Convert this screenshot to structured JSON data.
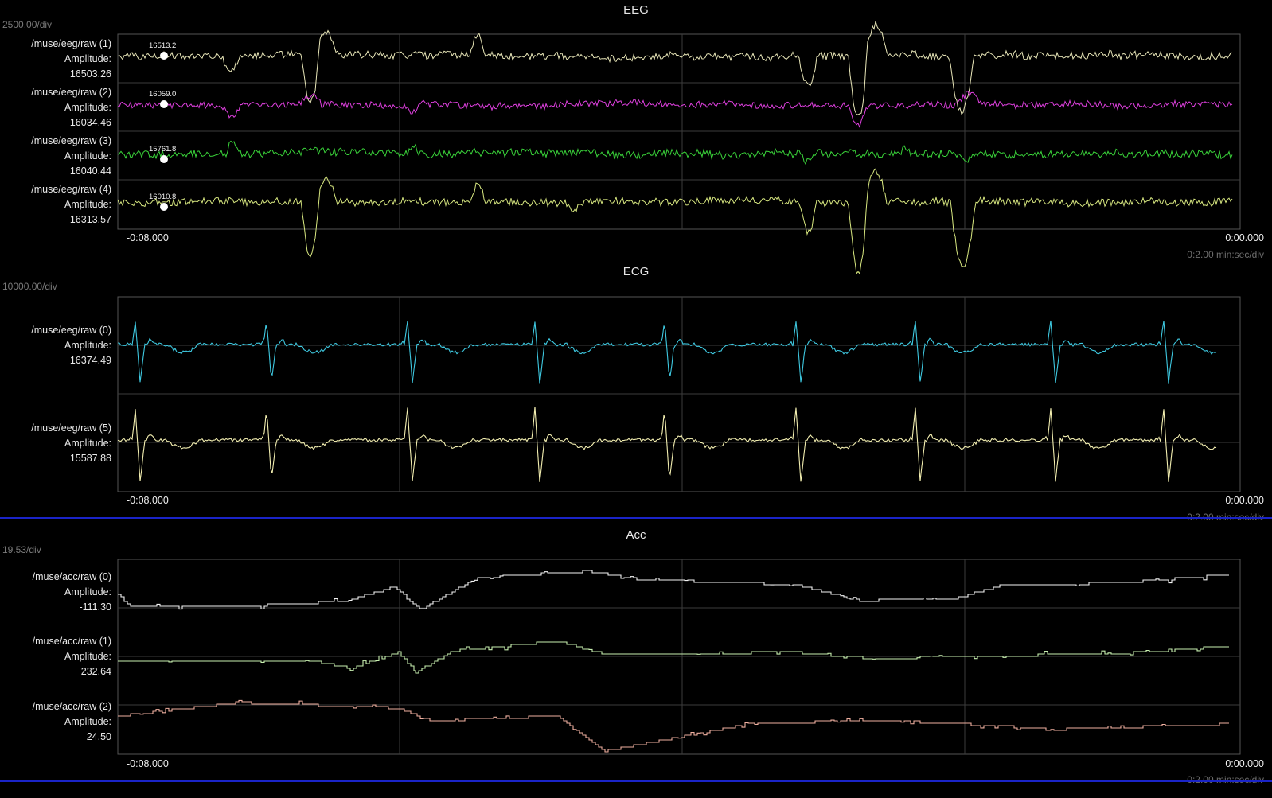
{
  "eeg": {
    "title": "EEG",
    "scale": "2500.00/div",
    "time_left": "-0:08.000",
    "time_right": "0:00.000",
    "time_div": "0:2.00 min:sec/div",
    "channels": [
      {
        "name": "/muse/eeg/raw (1)",
        "amp_label": "Amplitude:",
        "value": "16503.26",
        "cursor": "16513.2",
        "color": "#e8e6b8"
      },
      {
        "name": "/muse/eeg/raw (2)",
        "amp_label": "Amplitude:",
        "value": "16034.46",
        "cursor": "16059.0",
        "color": "#e040e0"
      },
      {
        "name": "/muse/eeg/raw (3)",
        "amp_label": "Amplitude:",
        "value": "16040.44",
        "cursor": "15761.8",
        "color": "#3ad43a"
      },
      {
        "name": "/muse/eeg/raw (4)",
        "amp_label": "Amplitude:",
        "value": "16313.57",
        "cursor": "16010.8",
        "color": "#d8e880"
      }
    ]
  },
  "ecg": {
    "title": "ECG",
    "scale": "10000.00/div",
    "time_left": "-0:08.000",
    "time_right": "0:00.000",
    "time_div": "0:2.00 min:sec/div",
    "channels": [
      {
        "name": "/muse/eeg/raw (0)",
        "amp_label": "Amplitude:",
        "value": "16374.49",
        "color": "#3ec8e0"
      },
      {
        "name": "/muse/eeg/raw (5)",
        "amp_label": "Amplitude:",
        "value": "15587.88",
        "color": "#f2eeb0"
      }
    ]
  },
  "acc": {
    "title": "Acc",
    "scale": "19.53/div",
    "time_left": "-0:08.000",
    "time_right": "0:00.000",
    "time_div": "0:2.00 min:sec/div",
    "channels": [
      {
        "name": "/muse/acc/raw (0)",
        "amp_label": "Amplitude:",
        "value": "-111.30",
        "color": "#f4f4f4"
      },
      {
        "name": "/muse/acc/raw (1)",
        "amp_label": "Amplitude:",
        "value": "232.64",
        "color": "#c8f0b0"
      },
      {
        "name": "/muse/acc/raw (2)",
        "amp_label": "Amplitude:",
        "value": "24.50",
        "color": "#f0b0a0"
      }
    ]
  },
  "separator_color": "#1a24c8"
}
